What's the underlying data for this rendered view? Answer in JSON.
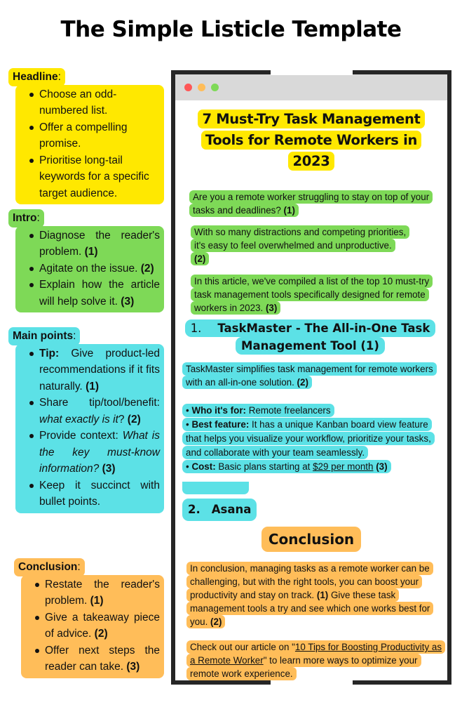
{
  "title": "The Simple Listicle Template",
  "colors": {
    "headline": "#FFE800",
    "intro": "#7ED957",
    "main_points": "#5CE1E6",
    "conclusion": "#FFBD59",
    "frame": "#262626",
    "browser_bar": "#D9D9D9",
    "dot_red": "#FF5757",
    "dot_amber": "#FFBD59",
    "dot_green": "#7ED957"
  },
  "sidebar": {
    "headline": {
      "label": "Headline",
      "colon": ":",
      "items": [
        {
          "text": "Choose an odd-numbered list."
        },
        {
          "text": "Offer a compelling promise."
        },
        {
          "text": "Prioritise long-tail keywords for a specific target audience."
        }
      ]
    },
    "intro": {
      "label": "Intro",
      "colon": ":",
      "items": [
        {
          "text": "Diagnose the reader's problem. ",
          "ref": "(1)"
        },
        {
          "text": "Agitate on the issue. ",
          "ref": "(2)"
        },
        {
          "text": "Explain how the article will help solve it. ",
          "ref": "(3)"
        }
      ]
    },
    "main_points": {
      "label": "Main points",
      "colon": ":",
      "items": [
        {
          "lead": "Tip:",
          "text": " Give product-led recommendations if it fits naturally. ",
          "ref": "(1)"
        },
        {
          "text": "Share tip/tool/benefit: ",
          "italic": "what exactly is it",
          "after": "? ",
          "ref": "(2)"
        },
        {
          "text": "Provide context: ",
          "italic": "What is the key must-know information?",
          "after": " ",
          "ref": "(3)"
        },
        {
          "text": "Keep it succinct with bullet points."
        }
      ]
    },
    "conclusion": {
      "label": "Conclusion",
      "colon": ":",
      "items": [
        {
          "text": "Restate the reader's problem. ",
          "ref": "(1)"
        },
        {
          "text": "Give a takeaway piece of advice. ",
          "ref": "(2)"
        },
        {
          "text": "Offer next steps the reader can take. ",
          "ref": "(3)"
        }
      ]
    }
  },
  "article": {
    "title": "7 Must-Try Task Management Tools for Remote Workers in 2023",
    "intro": [
      {
        "text": "Are you a remote worker struggling to stay on top of your tasks and deadlines? ",
        "ref": "(1)"
      },
      {
        "text": "With so many distractions and competing priorities, it's easy to feel overwhelmed and unproductive. ",
        "ref": "(2)"
      },
      {
        "text": "In this article, we've compiled a list of the top 10 must-try task management tools specifically designed for remote workers in 2023. ",
        "ref": "(3)"
      }
    ],
    "tool1": {
      "number": "1.",
      "heading": "TaskMaster - The All-in-One Task Management Tool (1)",
      "description": "TaskMaster simplifies task management for remote workers with an all-in-one solution. ",
      "description_ref": "(2)",
      "who_label": "Who it's for:",
      "who_value": " Remote freelancers",
      "feature_label": "Best feature:",
      "feature_value": " It has a unique Kanban board view feature that helps you visualize your workflow, prioritize your tasks, and collaborate with your team seamlessly.",
      "cost_label": "Cost:",
      "cost_value": " Basic plans starting at ",
      "cost_link": "$29 per month",
      "cost_ref": "(3)",
      "bullet": "•"
    },
    "tool2": {
      "number": "2.",
      "heading": "Asana"
    },
    "conclusion": {
      "heading": "Conclusion",
      "p1_text": "In conclusion, managing tasks as a remote worker can be challenging, but with the right tools, you can boost your productivity and stay on track. ",
      "p1_ref1": "(1)",
      "p1_text2": " Give these task management tools a try and see which one works best for you. ",
      "p1_ref2": "(2)",
      "p2_before": "Check out our article on \"",
      "p2_link": "10 Tips for Boosting Productivity as a Remote Worker",
      "p2_after": "\" to learn more ways to optimize your remote work experience."
    }
  }
}
